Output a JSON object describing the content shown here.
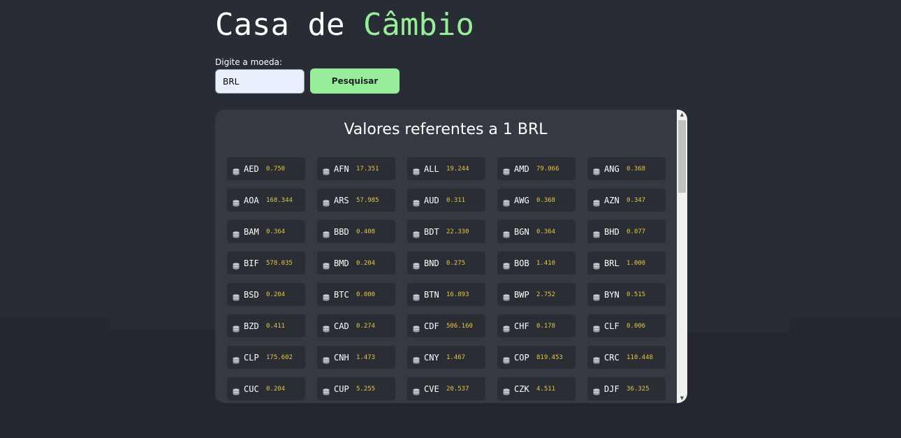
{
  "header": {
    "title_part1": "Casa de",
    "title_part2": "Câmbio"
  },
  "search": {
    "label": "Digite a moeda:",
    "value": "BRL",
    "button_label": "Pesquisar"
  },
  "results": {
    "heading": "Valores referentes a 1 BRL",
    "icon": "coins-icon",
    "colors": {
      "accent": "#98ed9a",
      "value": "#e8c547",
      "background": "#282c34",
      "panel": "#363942",
      "card": "#2a2d34"
    },
    "rates": [
      {
        "code": "AED",
        "value": "0.750"
      },
      {
        "code": "AFN",
        "value": "17.351"
      },
      {
        "code": "ALL",
        "value": "19.244"
      },
      {
        "code": "AMD",
        "value": "79.066"
      },
      {
        "code": "ANG",
        "value": "0.368"
      },
      {
        "code": "AOA",
        "value": "168.344"
      },
      {
        "code": "ARS",
        "value": "57.985"
      },
      {
        "code": "AUD",
        "value": "0.311"
      },
      {
        "code": "AWG",
        "value": "0.368"
      },
      {
        "code": "AZN",
        "value": "0.347"
      },
      {
        "code": "BAM",
        "value": "0.364"
      },
      {
        "code": "BBD",
        "value": "0.408"
      },
      {
        "code": "BDT",
        "value": "22.330"
      },
      {
        "code": "BGN",
        "value": "0.364"
      },
      {
        "code": "BHD",
        "value": "0.077"
      },
      {
        "code": "BIF",
        "value": "578.035"
      },
      {
        "code": "BMD",
        "value": "0.204"
      },
      {
        "code": "BND",
        "value": "0.275"
      },
      {
        "code": "BOB",
        "value": "1.410"
      },
      {
        "code": "BRL",
        "value": "1.000"
      },
      {
        "code": "BSD",
        "value": "0.204"
      },
      {
        "code": "BTC",
        "value": "0.000"
      },
      {
        "code": "BTN",
        "value": "16.893"
      },
      {
        "code": "BWP",
        "value": "2.752"
      },
      {
        "code": "BYN",
        "value": "0.515"
      },
      {
        "code": "BZD",
        "value": "0.411"
      },
      {
        "code": "CAD",
        "value": "0.274"
      },
      {
        "code": "CDF",
        "value": "506.160"
      },
      {
        "code": "CHF",
        "value": "0.178"
      },
      {
        "code": "CLF",
        "value": "0.006"
      },
      {
        "code": "CLP",
        "value": "175.602"
      },
      {
        "code": "CNH",
        "value": "1.473"
      },
      {
        "code": "CNY",
        "value": "1.467"
      },
      {
        "code": "COP",
        "value": "819.453"
      },
      {
        "code": "CRC",
        "value": "110.448"
      },
      {
        "code": "CUC",
        "value": "0.204"
      },
      {
        "code": "CUP",
        "value": "5.255"
      },
      {
        "code": "CVE",
        "value": "20.537"
      },
      {
        "code": "CZK",
        "value": "4.511"
      },
      {
        "code": "DJF",
        "value": "36.325"
      }
    ]
  }
}
